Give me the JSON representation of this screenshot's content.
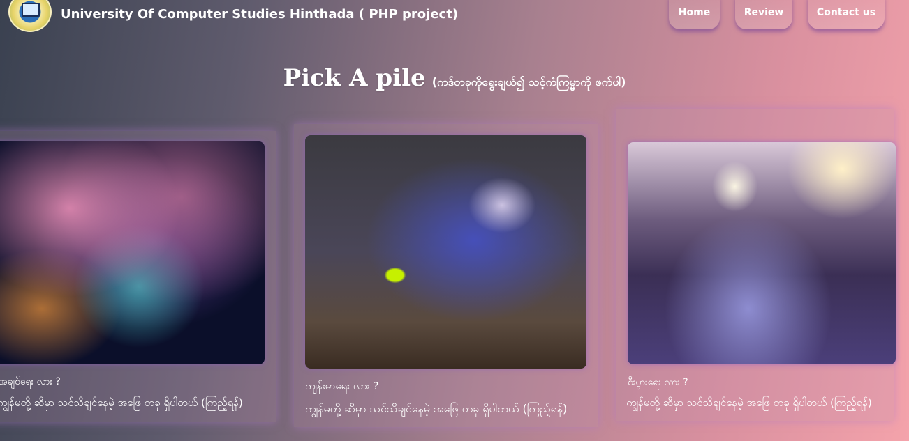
{
  "header": {
    "logo_name": "ucs-hinthada-logo",
    "title": "University Of Computer Studies Hinthada ( PHP project)",
    "nav": [
      {
        "label": "Home"
      },
      {
        "label": "Review"
      },
      {
        "label": "Contact us"
      }
    ]
  },
  "main": {
    "heading": "Pick A pile",
    "subheading": "(ကဒ်တခုကိုရွေးချယ်၍ သင့်ကံကြမ္မာကို ဖက်ပါ)"
  },
  "cards": [
    {
      "image_icon": "galaxy-image",
      "title": "အချစ်ရေး လား ?",
      "description": "ကျွန်မတို့ ဆီမှာ သင်သိချင်နေမဲ့ အဖြေ တခု ရှိပါတယ် (ကြည့်ရန်)"
    },
    {
      "image_icon": "tarot-reader-image",
      "title": "ကျန်းမာရေး လား ?",
      "description": "ကျွန်မတို့ ဆီမှာ သင်သိချင်နေမဲ့ အဖြေ တခု ရှိပါတယ် (ကြည့်ရန်)"
    },
    {
      "image_icon": "candles-tarot-image",
      "title": "စီးပွားရေး လား ?",
      "description": "ကျွန်မတို့ ဆီမှာ သင်သိချင်နေမဲ့ အဖြေ တခု ရှိပါတယ် (ကြည့်ရန်)"
    }
  ],
  "colors": {
    "gradient_left": "#3a4150",
    "gradient_right": "#f4a3ab",
    "card_glow": "#af78c8"
  }
}
